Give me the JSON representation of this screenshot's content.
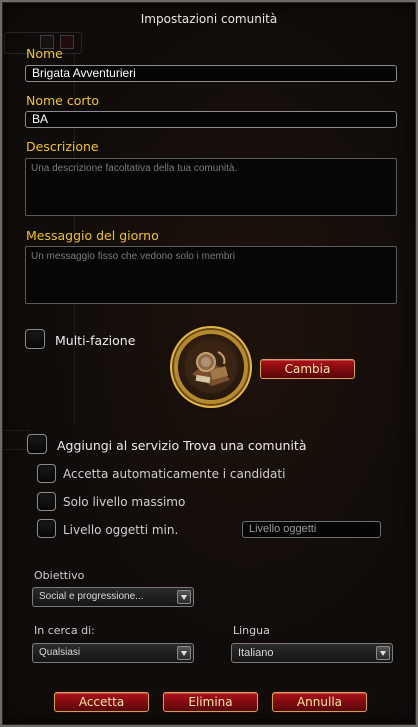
{
  "window": {
    "title": "Impostazioni comunità"
  },
  "name": {
    "label": "Nome",
    "value": "Brigata Avventurieri"
  },
  "short_name": {
    "label": "Nome corto",
    "value": "BA"
  },
  "description": {
    "label": "Descrizione",
    "placeholder": "Una descrizione facoltativa della tua comunità."
  },
  "motd": {
    "label": "Messaggio del giorno",
    "placeholder": "Un messaggio fisso che vedono solo i membri"
  },
  "multifaction": {
    "label": "Multi-fazione",
    "checked": false
  },
  "icon": {
    "change_label": "Cambia",
    "icon_name": "community-emblem-icon"
  },
  "finder": {
    "add_label": "Aggiungi al servizio Trova una comunità",
    "auto_accept_label": "Accetta automaticamente i candidati",
    "max_level_label": "Solo livello massimo",
    "min_ilvl_label": "Livello oggetti min.",
    "ilvl_placeholder": "Livello oggetti"
  },
  "objective": {
    "label": "Obiettivo",
    "value": "Social e progressione..."
  },
  "looking_for": {
    "label": "In cerca di:",
    "value": "Qualsiasi"
  },
  "language": {
    "label": "Lingua",
    "value": "Italiano"
  },
  "buttons": {
    "accept": "Accetta",
    "delete": "Elimina",
    "cancel": "Annulla"
  },
  "colors": {
    "label_gold": "#f0c419",
    "button_red": "#9e1016",
    "border_gold": "#c9a45a"
  }
}
